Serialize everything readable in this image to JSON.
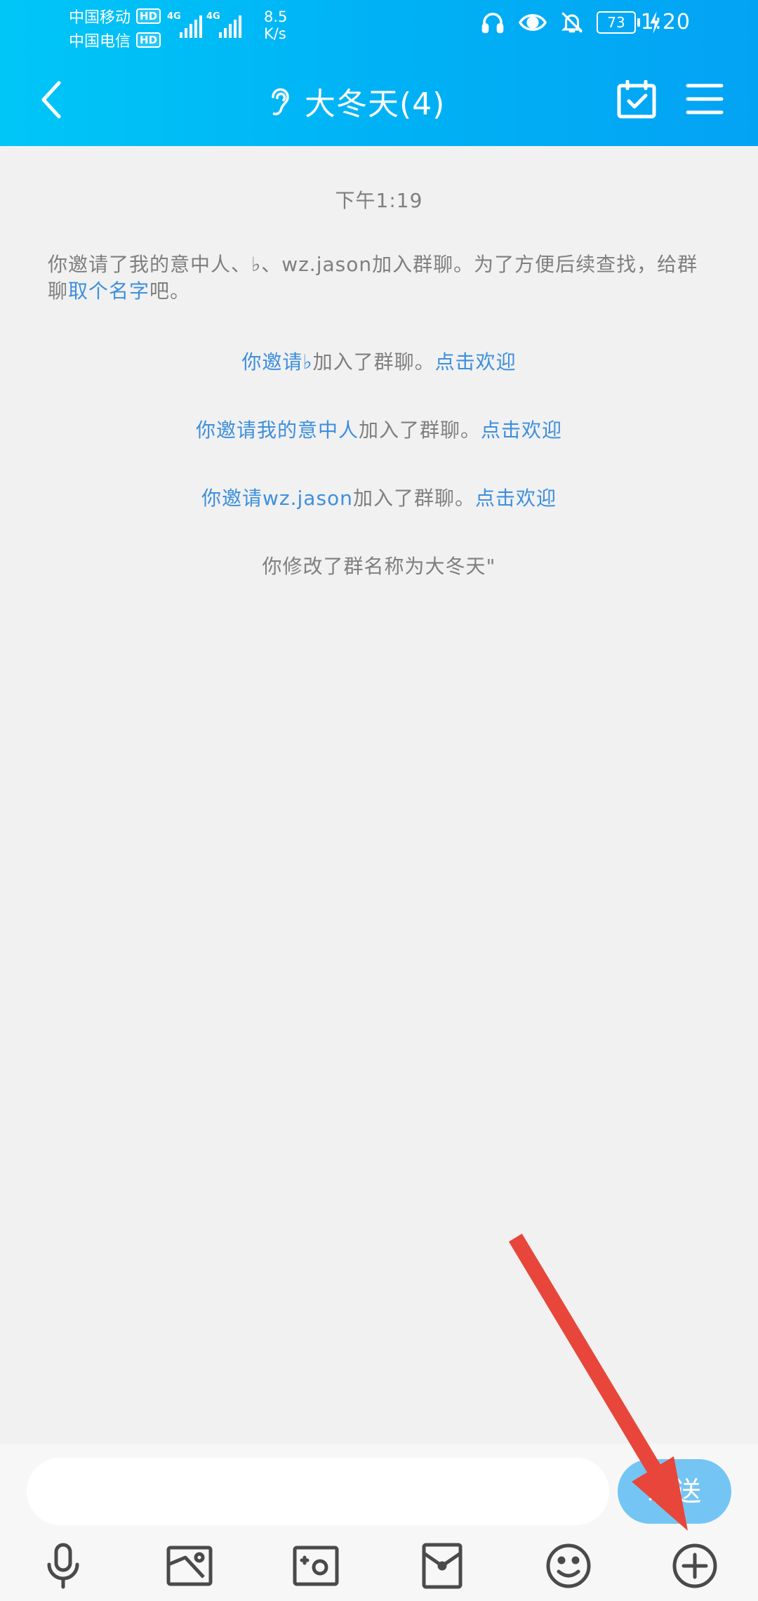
{
  "status_bar": {
    "carrier_1": "中国移动",
    "carrier_2": "中国电信",
    "hd_badge": "HD",
    "network_1": "4G",
    "network_2": "4G",
    "net_speed_value": "8.5",
    "net_speed_unit": "K/s",
    "battery": "73",
    "time": "1:20"
  },
  "header": {
    "title": "大冬天(4)",
    "icons": [
      "back-arrow-icon",
      "ear-icon",
      "calendar-check-icon",
      "menu-icon"
    ]
  },
  "chat": {
    "timestamp": "下午1:19",
    "first_message": {
      "part1": "你邀请了我的意中人、♭、wz.jason加入群聊。为了方便后续查找，给群聊",
      "link": "取个名字",
      "part2": "吧。"
    },
    "invites": [
      {
        "prefix": "你邀请",
        "name": "♭",
        "middle": "加入了群聊。",
        "link": "点击欢迎"
      },
      {
        "prefix": "你邀请",
        "name": "我的意中人",
        "middle": "加入了群聊。",
        "link": "点击欢迎"
      },
      {
        "prefix": "你邀请",
        "name": "wz.jason",
        "middle": "加入了群聊。",
        "link": "点击欢迎"
      }
    ],
    "rename_notice": "你修改了群名称为大冬天\""
  },
  "input": {
    "placeholder": "",
    "send_label": "发送"
  },
  "toolbar": {
    "icons": [
      "microphone-icon",
      "image-icon",
      "camera-icon",
      "red-packet-icon",
      "emoji-icon",
      "plus-icon"
    ]
  },
  "colors": {
    "header_start": "#00c6f7",
    "header_end": "#03a3f3",
    "link_blue": "#3d8fdd",
    "send_button": "#74c5f4",
    "annotation_red": "#e8463a"
  }
}
